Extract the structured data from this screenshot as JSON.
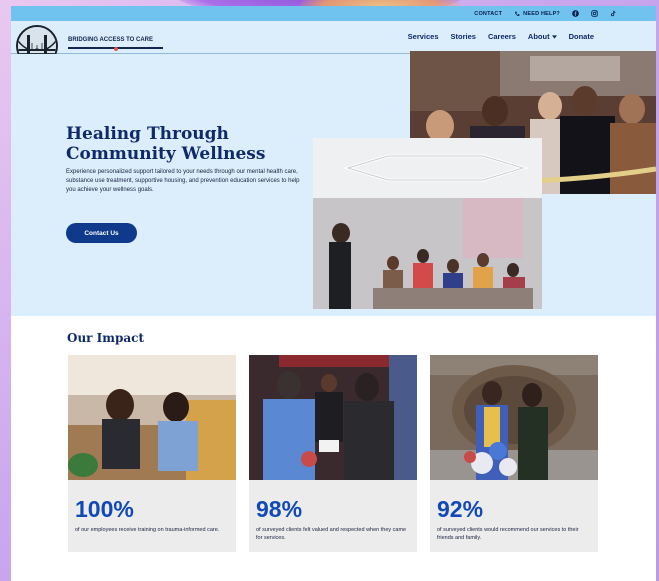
{
  "topbar": {
    "contact": "CONTACT",
    "need_help": "NEED HELP?",
    "icons": [
      "phone-icon",
      "facebook-icon",
      "instagram-icon",
      "tiktok-icon"
    ]
  },
  "header": {
    "brand": "BRIDGING ACCESS TO CARE",
    "nav": [
      "Services",
      "Stories",
      "Careers",
      "About",
      "Donate"
    ]
  },
  "hero": {
    "title_line1": "Healing Through",
    "title_line2": "Community Wellness",
    "description": "Experience personalized support tailored to your needs through our mental health care, substance use treatment, supportive housing, and prevention education services to help you achieve your wellness goals.",
    "cta": "Contact Us"
  },
  "impact": {
    "title": "Our Impact",
    "cards": [
      {
        "stat": "100%",
        "caption": "of our employees receive training on trauma-informed care."
      },
      {
        "stat": "98%",
        "caption": "of surveyed clients felt valued and respected when they came for services."
      },
      {
        "stat": "92%",
        "caption": "of surveyed clients would recommend our services to their friends and family."
      }
    ]
  },
  "colors": {
    "primary": "#0f2a6b",
    "accent_blue": "#1149b7",
    "topbar": "#6fc3ee",
    "hero_bg": "#dcedfb"
  }
}
